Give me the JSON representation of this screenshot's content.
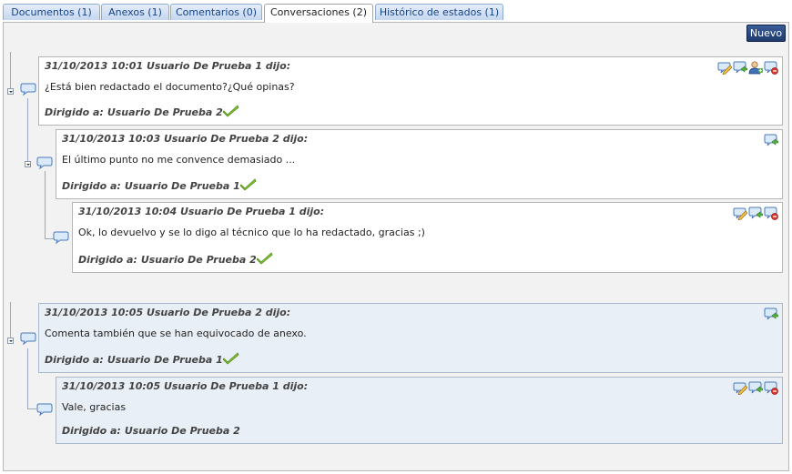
{
  "tabs": [
    {
      "label": "Documentos (1)"
    },
    {
      "label": "Anexos (1)"
    },
    {
      "label": "Comentarios (0)"
    },
    {
      "label": "Conversaciones (2)"
    },
    {
      "label": "Histórico de estados (1)"
    }
  ],
  "active_tab": "Conversaciones (2)",
  "new_button": "Nuevo",
  "directed_label": "Dirigido a:",
  "messages": [
    {
      "header": "31/10/2013 10:01 Usuario De Prueba 1 dijo:",
      "body": "¿Está bien redactado el documento?¿Qué opinas?",
      "recipient": "Usuario De Prueba 2",
      "read": true
    },
    {
      "header": "31/10/2013 10:03 Usuario De Prueba 2 dijo:",
      "body": "El último punto no me convence demasiado ...",
      "recipient": "Usuario De Prueba 1",
      "read": true
    },
    {
      "header": "31/10/2013 10:04 Usuario De Prueba 1 dijo:",
      "body": "Ok, lo devuelvo y se lo digo al técnico que lo ha redactado, gracias ;)",
      "recipient": "Usuario De Prueba 2",
      "read": true
    },
    {
      "header": "31/10/2013 10:05 Usuario De Prueba 2 dijo:",
      "body": "Comenta también que se han equivocado de anexo.",
      "recipient": "Usuario De Prueba 1",
      "read": true
    },
    {
      "header": "31/10/2013 10:05 Usuario De Prueba 1 dijo:",
      "body": "Vale, gracias",
      "recipient": "Usuario De Prueba 2",
      "read": false
    }
  ],
  "icons": {
    "edit": "edit-comment-icon",
    "reply": "reply-comment-icon",
    "add_user": "add-recipient-icon",
    "delete": "delete-comment-icon",
    "node": "speech-bubble-icon",
    "read": "read-check-icon"
  }
}
